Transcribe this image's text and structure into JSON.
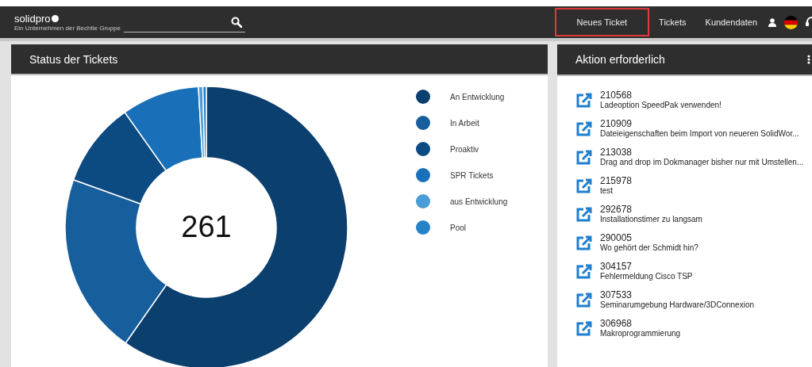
{
  "header": {
    "logo": "solidpro",
    "tagline": "Ein Unternehmen der Bechtle Gruppe",
    "nav": [
      {
        "label": "Neues Ticket",
        "highlighted": true
      },
      {
        "label": "Tickets",
        "highlighted": false
      },
      {
        "label": "Kundendaten",
        "highlighted": false
      }
    ]
  },
  "status_panel": {
    "title": "Status der Tickets",
    "total": "261",
    "legend": [
      {
        "label": "An Entwicklung",
        "color": "#0b3f6e"
      },
      {
        "label": "In Arbeit",
        "color": "#175f9c"
      },
      {
        "label": "Proaktiv",
        "color": "#0c4b82"
      },
      {
        "label": "SPR Tickets",
        "color": "#1a70b8"
      },
      {
        "label": "aus Entwicklung",
        "color": "#4a9cd8"
      },
      {
        "label": "Pool",
        "color": "#2682c8"
      }
    ]
  },
  "action_panel": {
    "title": "Aktion erforderlich",
    "items": [
      {
        "number": "210568",
        "text": "Ladeoption SpeedPak verwenden!"
      },
      {
        "number": "210909",
        "text": "Dateieigenschaften beim Import von neueren SolidWor..."
      },
      {
        "number": "213038",
        "text": "Drag and drop im Dokmanager bisher nur mit Umstellen..."
      },
      {
        "number": "215978",
        "text": "test"
      },
      {
        "number": "292678",
        "text": "Installationstimer zu langsam"
      },
      {
        "number": "290005",
        "text": "Wo gehört der Schmidt hin?"
      },
      {
        "number": "304157",
        "text": "Fehlermeldung Cisco TSP"
      },
      {
        "number": "307533",
        "text": "Seminarumgebung Hardware/3DConnexion"
      },
      {
        "number": "306968",
        "text": "Makroprogrammierung"
      }
    ]
  }
}
